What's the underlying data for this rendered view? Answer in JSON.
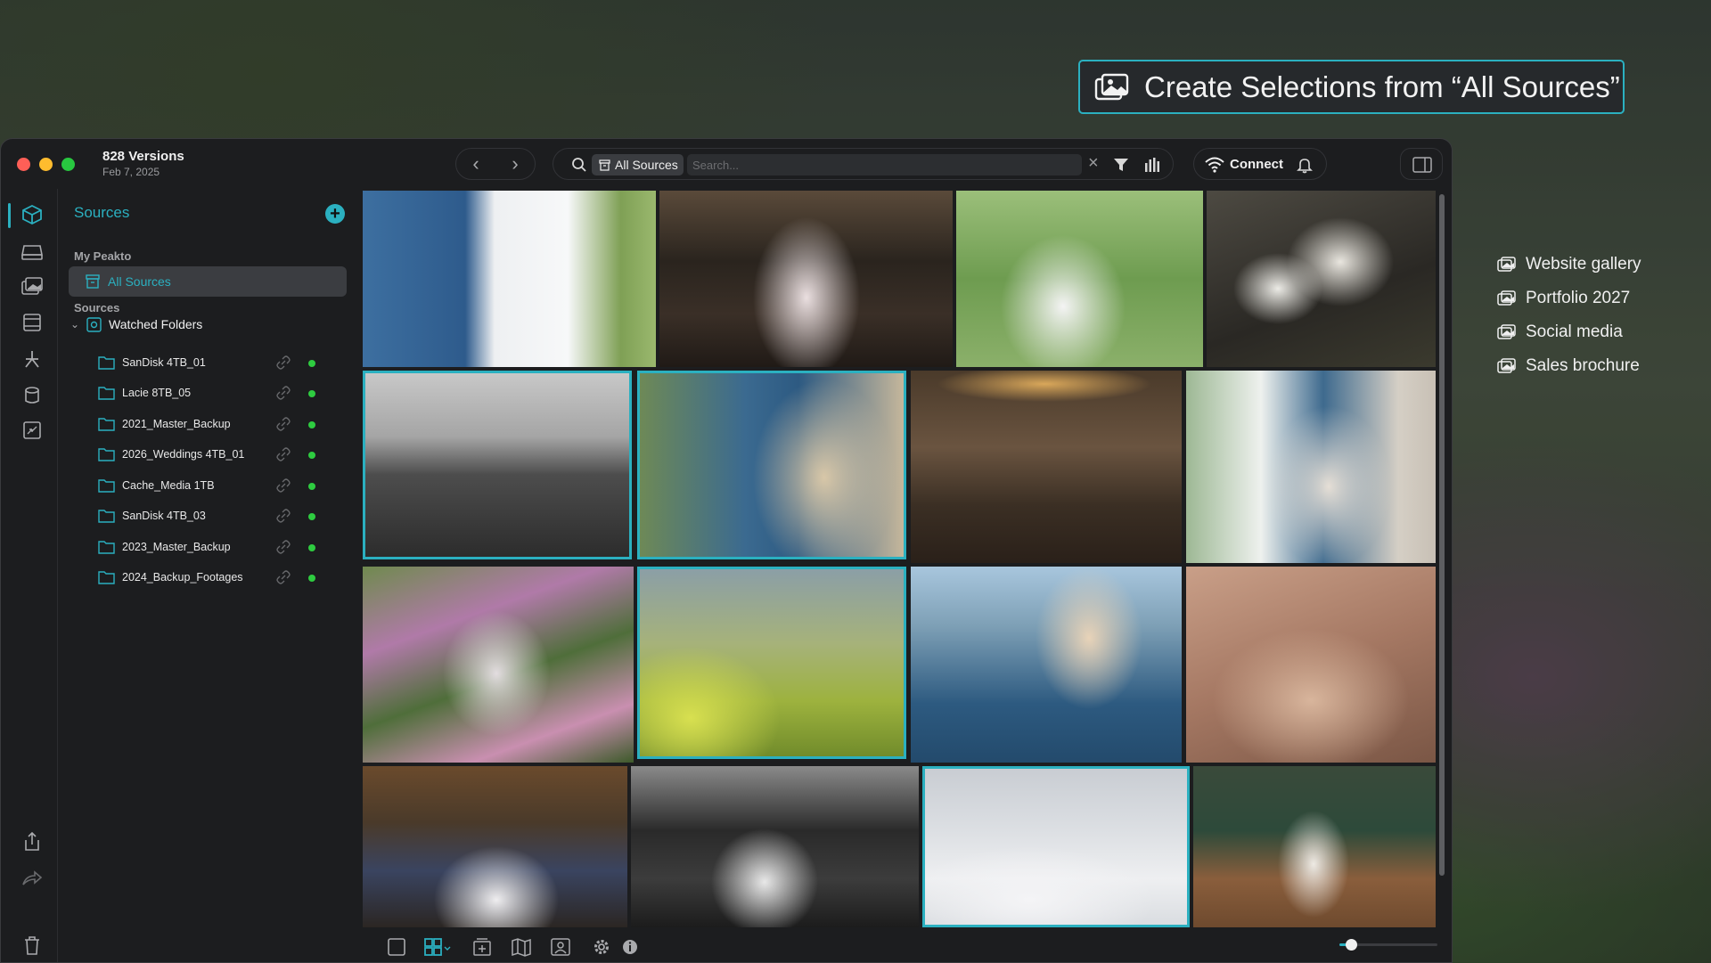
{
  "banner": {
    "text": "Create Selections from “All Sources”",
    "icon": "photos-icon"
  },
  "selections": [
    {
      "label": "Website gallery",
      "icon": "photos-icon"
    },
    {
      "label": "Portfolio 2027",
      "icon": "photos-icon"
    },
    {
      "label": "Social media",
      "icon": "photos-icon"
    },
    {
      "label": "Sales brochure",
      "icon": "photos-icon"
    }
  ],
  "window": {
    "title": "828 Versions",
    "date": "Feb 7, 2025"
  },
  "search": {
    "chip_label": "All Sources",
    "placeholder": "Search..."
  },
  "connect": {
    "label": "Connect"
  },
  "sidebar": {
    "title": "Sources",
    "section_my": "My Peakto",
    "all_sources": "All Sources",
    "section_sources": "Sources",
    "watched_folders": "Watched Folders",
    "folders": [
      {
        "name": "SanDisk 4TB_01"
      },
      {
        "name": "Lacie 8TB_05"
      },
      {
        "name": "2021_Master_Backup"
      },
      {
        "name": "2026_Weddings 4TB_01"
      },
      {
        "name": "Cache_Media 1TB"
      },
      {
        "name": "SanDisk 4TB_03"
      },
      {
        "name": "2023_Master_Backup"
      },
      {
        "name": "2024_Backup_Footages"
      }
    ]
  },
  "zoom": {
    "level": 0.12
  },
  "colors": {
    "accent": "#2bb0c0",
    "online": "#2ecc40",
    "window_bg": "#1c1d1f"
  }
}
